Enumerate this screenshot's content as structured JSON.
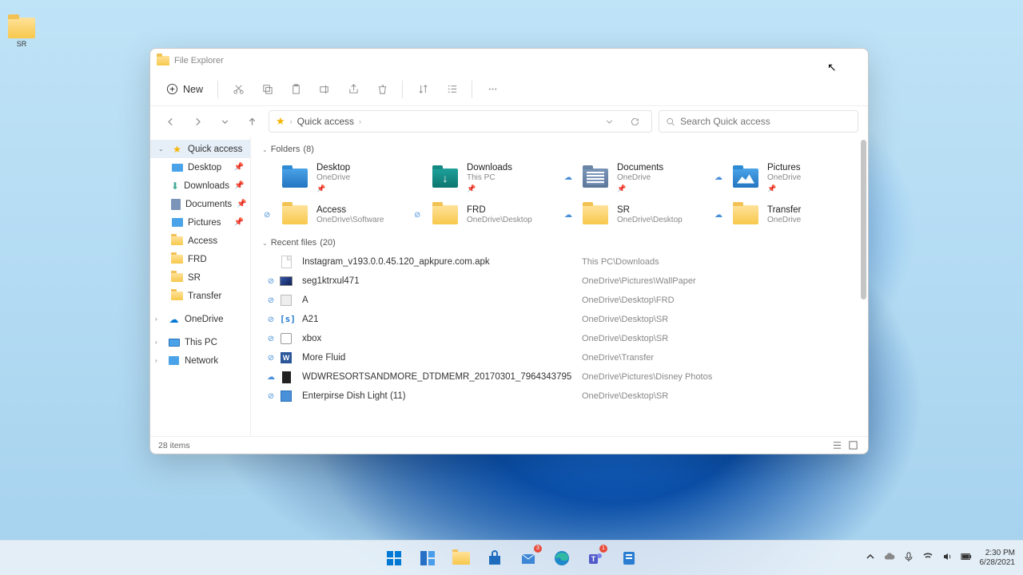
{
  "desktop": {
    "icon_label": "SR"
  },
  "window": {
    "title": "File Explorer",
    "toolbar": {
      "new": "New",
      "cut": "Cut",
      "copy": "Copy",
      "paste": "Paste",
      "rename": "Rename",
      "share": "Share",
      "delete": "Delete",
      "sort": "Sort",
      "view": "View",
      "more": "More"
    },
    "breadcrumbs": [
      "Quick access"
    ],
    "search_placeholder": "Search Quick access",
    "sidebar": [
      {
        "label": "Quick access",
        "kind": "star",
        "expandable": true,
        "expanded": true,
        "selected": true,
        "pinned": false
      },
      {
        "label": "Desktop",
        "kind": "desktop",
        "sub": true,
        "pinned": true
      },
      {
        "label": "Downloads",
        "kind": "download",
        "sub": true,
        "pinned": true
      },
      {
        "label": "Documents",
        "kind": "document",
        "sub": true,
        "pinned": true
      },
      {
        "label": "Pictures",
        "kind": "picture",
        "sub": true,
        "pinned": true
      },
      {
        "label": "Access",
        "kind": "folder",
        "sub": true,
        "pinned": false
      },
      {
        "label": "FRD",
        "kind": "folder",
        "sub": true,
        "pinned": false
      },
      {
        "label": "SR",
        "kind": "folder",
        "sub": true,
        "pinned": false
      },
      {
        "label": "Transfer",
        "kind": "folder",
        "sub": true,
        "pinned": false
      },
      {
        "label": "OneDrive",
        "kind": "cloud",
        "expandable": true,
        "expanded": false,
        "root": true
      },
      {
        "label": "This PC",
        "kind": "pc",
        "expandable": true,
        "expanded": false,
        "root": true
      },
      {
        "label": "Network",
        "kind": "network",
        "expandable": true,
        "expanded": false,
        "root": true
      }
    ],
    "groups": {
      "folders": {
        "label": "Folders",
        "count": 8
      },
      "recent": {
        "label": "Recent files",
        "count": 20
      }
    },
    "folders": [
      {
        "name": "Desktop",
        "loc": "OneDrive",
        "icon": "desktop",
        "pinned": true,
        "sync": ""
      },
      {
        "name": "Downloads",
        "loc": "This PC",
        "icon": "download",
        "pinned": true,
        "sync": ""
      },
      {
        "name": "Documents",
        "loc": "OneDrive",
        "icon": "documents",
        "pinned": true,
        "sync": "cloud"
      },
      {
        "name": "Pictures",
        "loc": "OneDrive",
        "icon": "pictures",
        "pinned": true,
        "sync": "cloud"
      },
      {
        "name": "Access",
        "loc": "OneDrive\\Software",
        "icon": "folder",
        "pinned": false,
        "sync": "check"
      },
      {
        "name": "FRD",
        "loc": "OneDrive\\Desktop",
        "icon": "folder",
        "pinned": false,
        "sync": "check"
      },
      {
        "name": "SR",
        "loc": "OneDrive\\Desktop",
        "icon": "folder",
        "pinned": false,
        "sync": "cloud"
      },
      {
        "name": "Transfer",
        "loc": "OneDrive",
        "icon": "folder",
        "pinned": false,
        "sync": "cloud"
      }
    ],
    "recent_files": [
      {
        "name": "Instagram_v193.0.0.45.120_apkpure.com.apk",
        "path": "This PC\\Downloads",
        "icon": "doc",
        "sync": ""
      },
      {
        "name": "seg1ktrxul471",
        "path": "OneDrive\\Pictures\\WallPaper",
        "icon": "pic",
        "sync": "check"
      },
      {
        "name": "A",
        "path": "OneDrive\\Desktop\\FRD",
        "icon": "txt",
        "sync": "check"
      },
      {
        "name": "A21",
        "path": "OneDrive\\Desktop\\SR",
        "icon": "code",
        "sync": "check"
      },
      {
        "name": "xbox",
        "path": "OneDrive\\Desktop\\SR",
        "icon": "xbox",
        "sync": "check"
      },
      {
        "name": "More Fluid",
        "path": "OneDrive\\Transfer",
        "icon": "word",
        "sync": "check"
      },
      {
        "name": "WDWRESORTSANDMORE_DTDMEMR_20170301_7964343795",
        "path": "OneDrive\\Pictures\\Disney Photos",
        "icon": "dark",
        "sync": "cloud"
      },
      {
        "name": "Enterpirse Dish Light (11)",
        "path": "OneDrive\\Desktop\\SR",
        "icon": "lnk",
        "sync": "check"
      }
    ],
    "status": {
      "items": "28 items"
    }
  },
  "taskbar": {
    "apps": [
      "start",
      "widgets",
      "explorer",
      "store",
      "mail",
      "edge",
      "teams",
      "tips"
    ],
    "tray": {
      "time": "2:30 PM",
      "date": "6/28/2021"
    }
  }
}
